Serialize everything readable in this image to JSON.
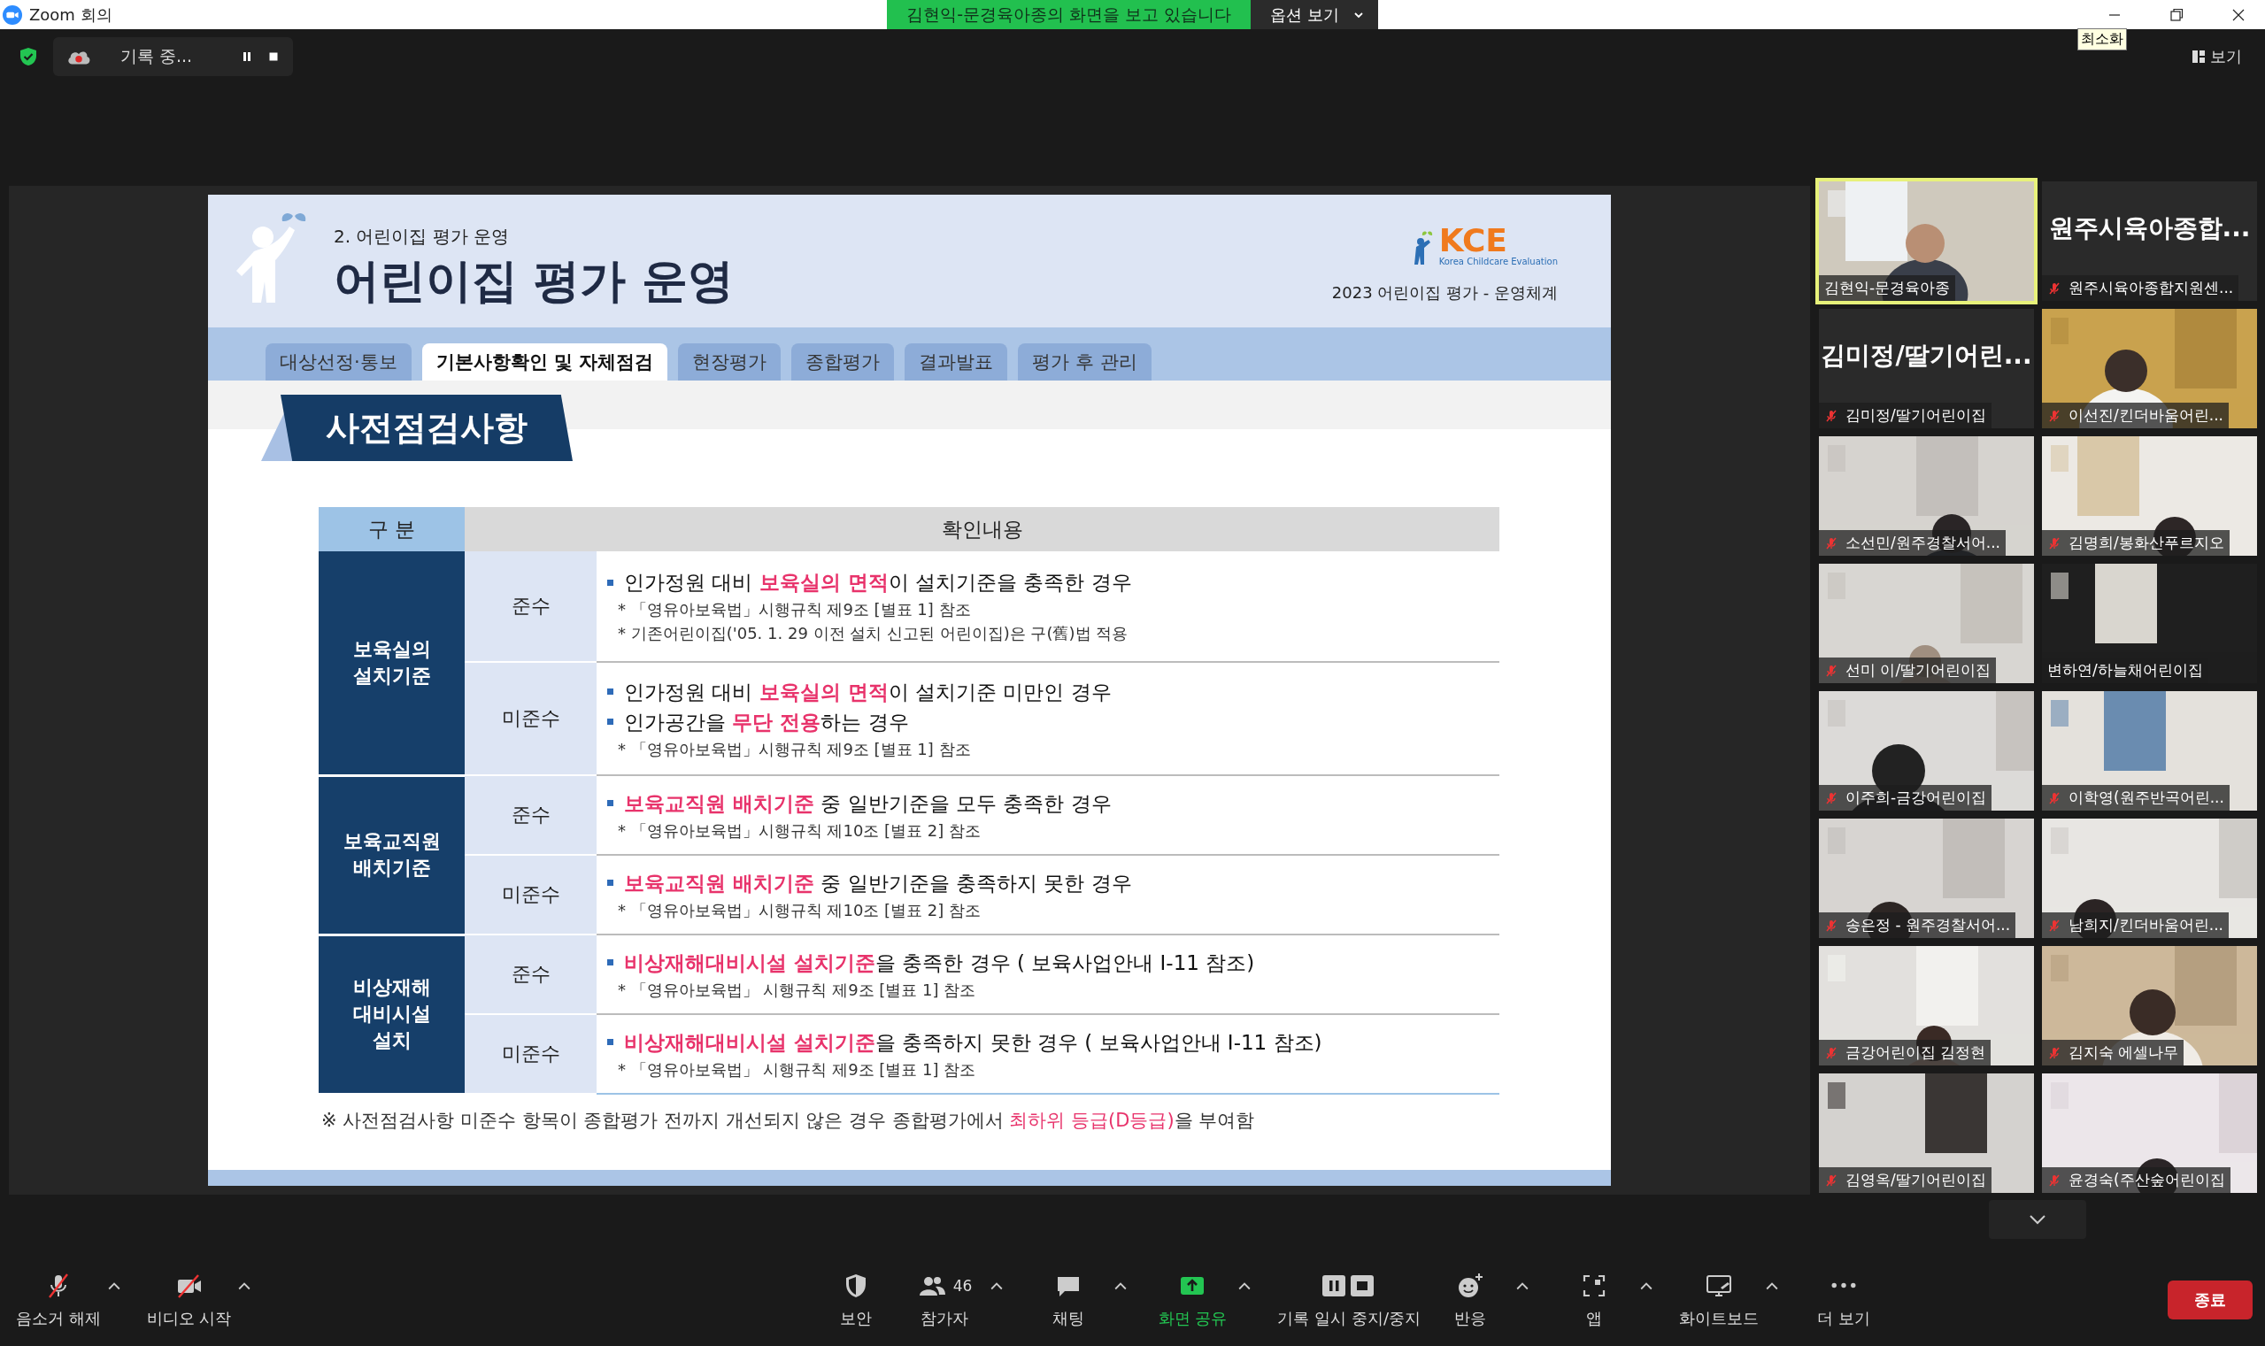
{
  "window": {
    "title": "Zoom 회의"
  },
  "share_banner": {
    "text": "김현익-문경육아종의 화면을 보고 있습니다",
    "options_button": "옵션 보기"
  },
  "tooltip": "최소화",
  "recording": {
    "label": "기록 중..."
  },
  "view_button": "보기",
  "slide": {
    "section": "2. 어린이집 평가 운영",
    "title": "어린이집 평가 운영",
    "logo": "KCE",
    "logo_subtitle": "Korea Childcare Evaluation",
    "caption": "2023 어린이집 평가 - 운영체계",
    "tabs": [
      {
        "label": "대상선정·통보",
        "selected": false
      },
      {
        "label": "기본사항확인 및 자체점검",
        "selected": true
      },
      {
        "label": "현장평가",
        "selected": false
      },
      {
        "label": "종합평가",
        "selected": false
      },
      {
        "label": "결과발표",
        "selected": false
      },
      {
        "label": "평가 후 관리",
        "selected": false
      }
    ],
    "heading": "사전점검사항",
    "table": {
      "columns": [
        "구 분",
        "확인내용"
      ],
      "groups": [
        {
          "category": "보육실의\n설치기준",
          "rows": [
            {
              "status": "준수",
              "lines": [
                {
                  "kind": "bullet",
                  "text": "인가정원 대비 **보육실의 면적**이 설치기준을 충족한 경우"
                },
                {
                  "kind": "note",
                  "text": "* 「영유아보육법」시행규칙 제9조 [별표 1] 참조"
                },
                {
                  "kind": "note",
                  "text": "* 기존어린이집('05. 1. 29 이전 설치 신고된 어린이집)은 구(舊)법 적용"
                }
              ]
            },
            {
              "status": "미준수",
              "lines": [
                {
                  "kind": "bullet",
                  "text": "인가정원 대비 **보육실의 면적**이 설치기준 미만인 경우"
                },
                {
                  "kind": "bullet",
                  "text": "인가공간을 **무단 전용**하는 경우"
                },
                {
                  "kind": "note",
                  "text": "* 「영유아보육법」시행규칙 제9조 [별표 1] 참조"
                }
              ]
            }
          ]
        },
        {
          "category": "보육교직원\n배치기준",
          "rows": [
            {
              "status": "준수",
              "lines": [
                {
                  "kind": "bullet",
                  "text": "**보육교직원 배치기준** 중 일반기준을 모두 충족한 경우"
                },
                {
                  "kind": "note",
                  "text": "* 「영유아보육법」시행규칙 제10조 [별표 2] 참조"
                }
              ]
            },
            {
              "status": "미준수",
              "lines": [
                {
                  "kind": "bullet",
                  "text": "**보육교직원 배치기준** 중 일반기준을 충족하지 못한 경우"
                },
                {
                  "kind": "note",
                  "text": "* 「영유아보육법」시행규칙 제10조 [별표 2] 참조"
                }
              ]
            }
          ]
        },
        {
          "category": "비상재해\n대비시설\n설치",
          "rows": [
            {
              "status": "준수",
              "lines": [
                {
                  "kind": "bullet",
                  "text": "**비상재해대비시설 설치기준**을 충족한 경우 ( 보육사업안내 Ⅰ-11 참조)"
                },
                {
                  "kind": "note",
                  "text": "* 「영유아보육법」 시행규칙 제9조 [별표 1] 참조"
                }
              ]
            },
            {
              "status": "미준수",
              "lines": [
                {
                  "kind": "bullet",
                  "text": "**비상재해대비시설 설치기준**을 충족하지 못한 경우 ( 보육사업안내 Ⅰ-11 참조)"
                },
                {
                  "kind": "note",
                  "text": "* 「영유아보육법」 시행규칙 제9조 [별표 1] 참조"
                }
              ]
            }
          ]
        }
      ]
    },
    "footnote": "※ 사전점검사항 미준수 항목이 종합평가 전까지 개선되지 않은 경우 종합평가에서 **최하위 등급(D등급)**을 부여함"
  },
  "participants": [
    {
      "kind": "video",
      "name": "김현익-문경육아종",
      "muted": false,
      "active": true
    },
    {
      "kind": "name",
      "display_name": "원주시육아종합...",
      "name": "원주시육아종합지원센...",
      "muted": true,
      "active": false
    },
    {
      "kind": "name",
      "display_name": "김미정/딸기어린...",
      "name": "김미정/딸기어린이집",
      "muted": true,
      "active": false
    },
    {
      "kind": "video",
      "name": "이선진/킨더바움어린...",
      "muted": true,
      "active": false
    },
    {
      "kind": "video",
      "name": "소선민/원주경찰서어...",
      "muted": true,
      "active": false
    },
    {
      "kind": "video",
      "name": "김명희/봉화산푸르지오",
      "muted": true,
      "active": false
    },
    {
      "kind": "video",
      "name": "선미 이/딸기어린이집",
      "muted": true,
      "active": false
    },
    {
      "kind": "video",
      "name": "변하연/하늘채어린이집",
      "muted": false,
      "active": false
    },
    {
      "kind": "video",
      "name": "이주희-금강어린이집",
      "muted": true,
      "active": false
    },
    {
      "kind": "video",
      "name": "이학영(원주반곡어린...",
      "muted": true,
      "active": false
    },
    {
      "kind": "video",
      "name": "송은정 - 원주경찰서어...",
      "muted": true,
      "active": false
    },
    {
      "kind": "video",
      "name": "남희지/킨더바움어린...",
      "muted": true,
      "active": false
    },
    {
      "kind": "video",
      "name": "금강어린이집 김정현",
      "muted": true,
      "active": false
    },
    {
      "kind": "video",
      "name": "김지숙 에셀나무",
      "muted": true,
      "active": false
    },
    {
      "kind": "video",
      "name": "김영옥/딸기어린이집",
      "muted": true,
      "active": false
    },
    {
      "kind": "video",
      "name": "윤경숙(주산숲어린이집",
      "muted": true,
      "active": false
    }
  ],
  "toolbar": [
    {
      "kind": "mic",
      "label": "음소거 해제",
      "menu": true
    },
    {
      "kind": "video",
      "label": "비디오 시작",
      "menu": true
    },
    {
      "kind": "security",
      "label": "보안",
      "menu": false
    },
    {
      "kind": "participants",
      "label": "참가자",
      "count": "46",
      "menu": true
    },
    {
      "kind": "chat",
      "label": "채팅",
      "menu": true
    },
    {
      "kind": "share",
      "label": "화면 공유",
      "menu": true
    },
    {
      "kind": "record",
      "label": "기록 일시 중지/중지",
      "menu": false
    },
    {
      "kind": "reactions",
      "label": "반응",
      "menu": true
    },
    {
      "kind": "apps",
      "label": "앱",
      "menu": true
    },
    {
      "kind": "whiteboard",
      "label": "화이트보드",
      "menu": true
    },
    {
      "kind": "more",
      "label": "더 보기",
      "menu": false
    }
  ],
  "end_button": "종료"
}
